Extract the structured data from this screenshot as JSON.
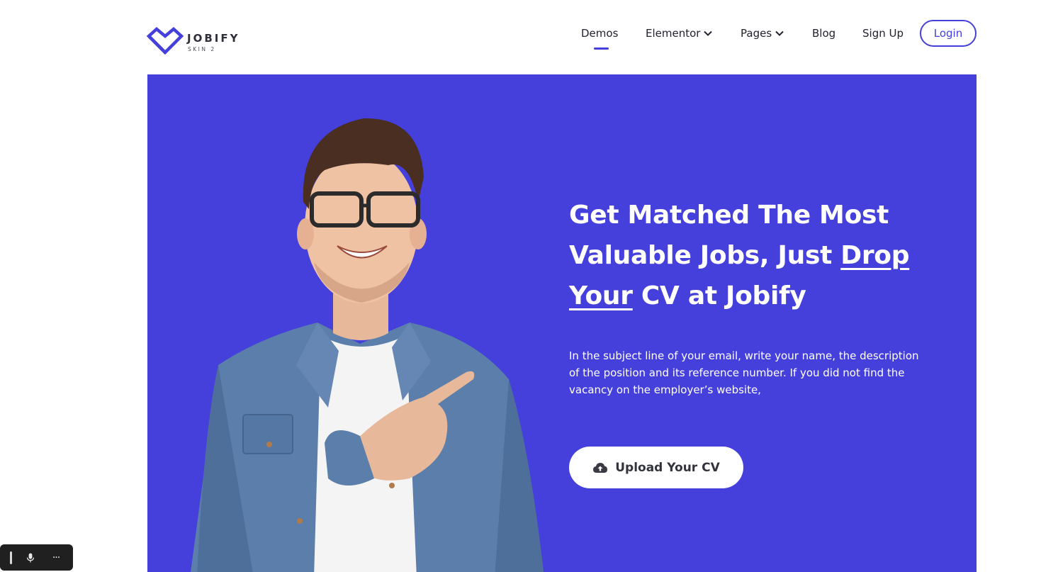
{
  "brand": {
    "name": "JOBIFY",
    "sub": "SKIN 2",
    "accent_color": "#4540dc"
  },
  "nav": {
    "items": [
      {
        "label": "Demos",
        "active": true,
        "dropdown": false
      },
      {
        "label": "Elementor",
        "active": false,
        "dropdown": true
      },
      {
        "label": "Pages",
        "active": false,
        "dropdown": true
      },
      {
        "label": "Blog",
        "active": false,
        "dropdown": false
      },
      {
        "label": "Sign Up",
        "active": false,
        "dropdown": false
      }
    ],
    "login_label": "Login"
  },
  "hero": {
    "headline_part1": "Get Matched The Most Valuable Jobs, Just ",
    "headline_underlined": "Drop Your",
    "headline_part2": " CV at Jobify",
    "description_lines": [
      "In the subject line of your email, write your name, the description",
      "of the position and its reference number. If you did not find the vacancy on the employer’s website,"
    ],
    "cta_label": "Upload Your CV",
    "cta_icon": "cloud-upload-icon",
    "background_color": "#4540dc"
  },
  "toolbar": {
    "icons": [
      "grip-icon",
      "microphone-icon",
      "more-icon"
    ],
    "more_label": "···"
  }
}
